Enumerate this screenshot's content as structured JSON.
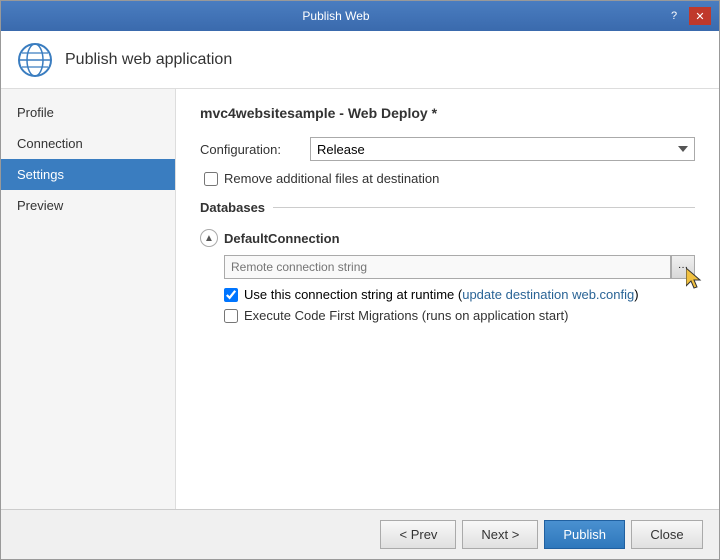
{
  "window": {
    "title": "Publish Web",
    "help_btn": "?",
    "close_btn": "✕"
  },
  "header": {
    "title": "Publish web application",
    "icon_label": "globe-icon"
  },
  "sidebar": {
    "items": [
      {
        "label": "Profile",
        "id": "profile",
        "active": false
      },
      {
        "label": "Connection",
        "id": "connection",
        "active": false
      },
      {
        "label": "Settings",
        "id": "settings",
        "active": true
      },
      {
        "label": "Preview",
        "id": "preview",
        "active": false
      }
    ]
  },
  "main": {
    "panel_title": "mvc4websitesample - Web Deploy *",
    "configuration_label": "Configuration:",
    "configuration_value": "Release",
    "remove_files_label": "Remove additional files at destination",
    "databases_section": "Databases",
    "db_name": "DefaultConnection",
    "db_placeholder": "Remote connection string",
    "use_connection_label": "Use this connection string at runtime (update destination web.config)",
    "execute_migrations_label": "Execute Code First Migrations (runs on application start)"
  },
  "footer": {
    "prev_btn": "< Prev",
    "next_btn": "Next >",
    "publish_btn": "Publish",
    "close_btn": "Close"
  }
}
